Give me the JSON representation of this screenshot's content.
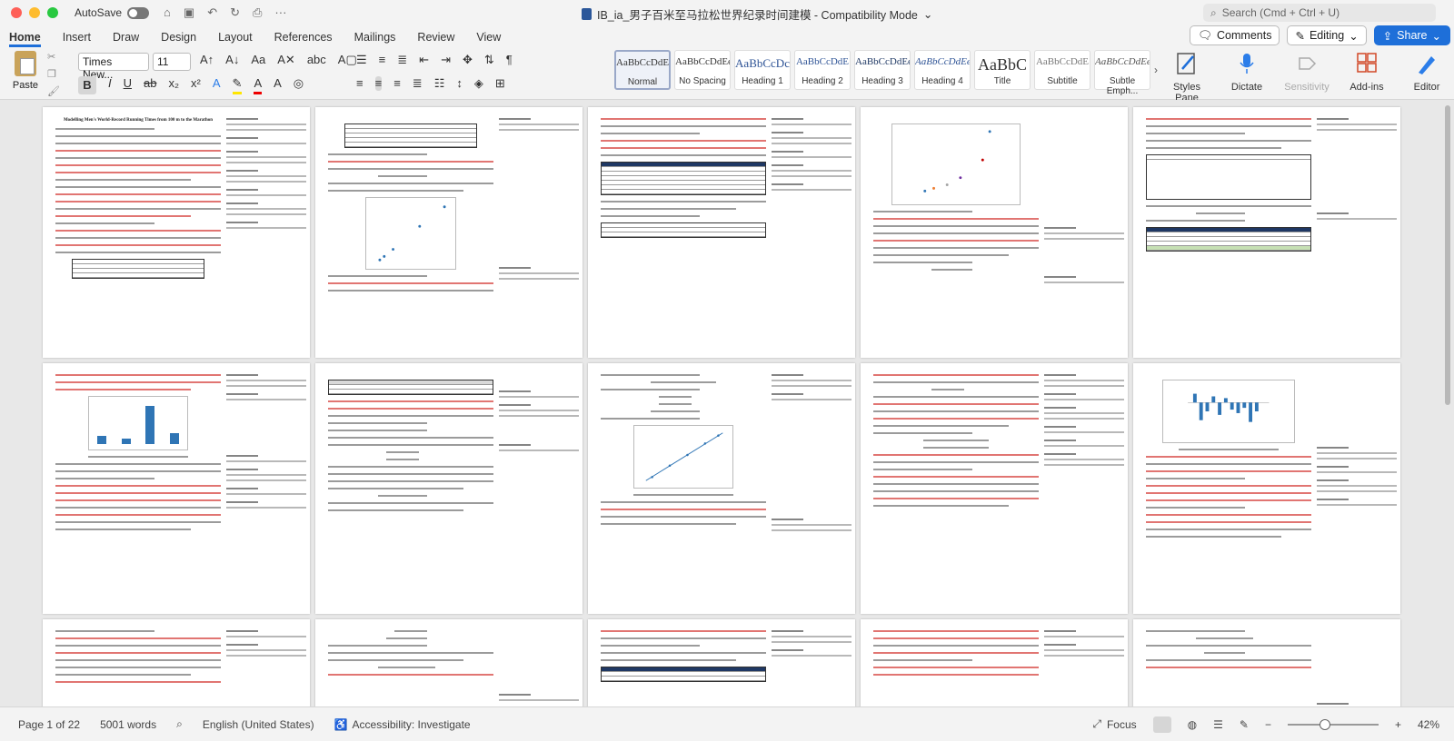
{
  "window": {
    "autosave_label": "AutoSave",
    "title": "IB_ia_男子百米至马拉松世界纪录时间建模  -  Compatibility Mode",
    "search_placeholder": "Search (Cmd + Ctrl + U)"
  },
  "tabs": [
    "Home",
    "Insert",
    "Draw",
    "Design",
    "Layout",
    "References",
    "Mailings",
    "Review",
    "View"
  ],
  "topright": {
    "comments": "Comments",
    "editing": "Editing",
    "share": "Share"
  },
  "ribbon": {
    "paste": "Paste",
    "font_name": "Times New...",
    "font_size": "11",
    "styles": [
      {
        "sample": "AaBbCcDdEe",
        "label": "Normal"
      },
      {
        "sample": "AaBbCcDdEe",
        "label": "No Spacing"
      },
      {
        "sample": "AaBbCcDc",
        "label": "Heading 1"
      },
      {
        "sample": "AaBbCcDdE",
        "label": "Heading 2"
      },
      {
        "sample": "AaBbCcDdEe",
        "label": "Heading 3"
      },
      {
        "sample": "AaBbCcDdEe",
        "label": "Heading 4"
      },
      {
        "sample": "AaBbC",
        "label": "Title"
      },
      {
        "sample": "AaBbCcDdE",
        "label": "Subtitle"
      },
      {
        "sample": "AaBbCcDdEe",
        "label": "Subtle Emph..."
      }
    ],
    "tools": [
      "Styles Pane",
      "Dictate",
      "Sensitivity",
      "Add-ins",
      "Editor"
    ]
  },
  "document": {
    "page1_title": "Modelling Men's World-Record Running Times from 100 m to the Marathon"
  },
  "status": {
    "page": "Page 1 of 22",
    "words": "5001 words",
    "language": "English (United States)",
    "accessibility": "Accessibility: Investigate",
    "focus": "Focus",
    "zoom": "42%"
  }
}
